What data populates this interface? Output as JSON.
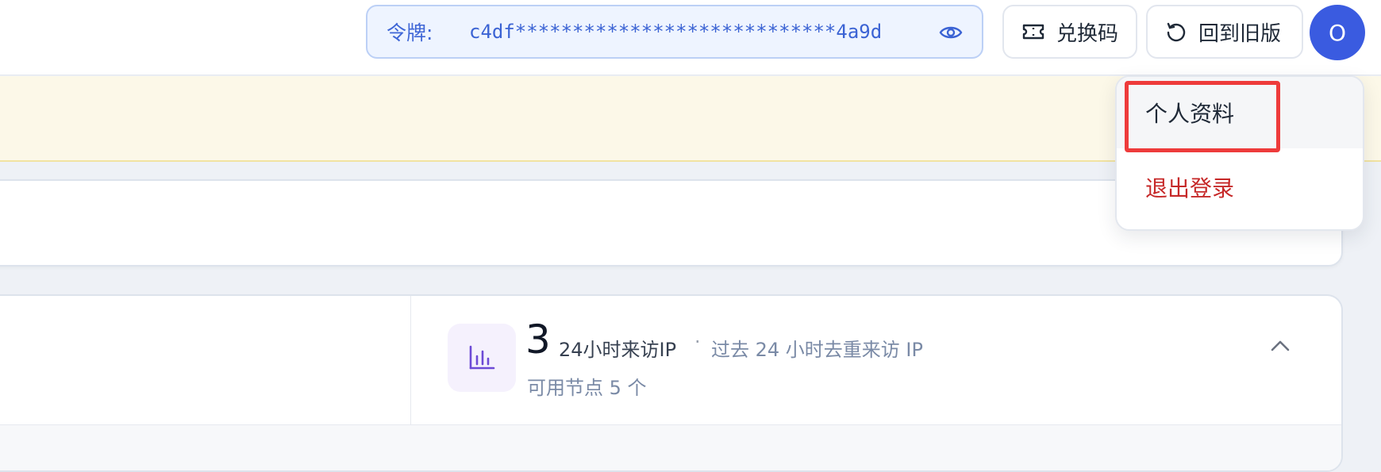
{
  "header": {
    "token_label": "令牌:",
    "token_value": "c4df****************************4a9d",
    "eye_icon": "eye-icon",
    "redeem_label": "兑换码",
    "redeem_icon": "ticket-icon",
    "old_version_label": "回到旧版",
    "old_version_icon": "rotate-ccw-icon",
    "avatar_initial": "O",
    "avatar_color": "#3a5be0"
  },
  "dropdown": {
    "items": [
      {
        "label": "个人资料",
        "icon": "",
        "highlighted": true
      },
      {
        "label": "退出登录",
        "color": "#c62828"
      }
    ]
  },
  "stat_card": {
    "icon": "bar-chart-icon",
    "value": "3",
    "label": "24小时来访IP",
    "separator": "·",
    "description": "过去 24 小时去重来访 IP",
    "sub": "可用节点 5 个",
    "collapse_icon": "chevron-up-icon"
  },
  "colors": {
    "accent": "#3b63d4",
    "banner": "#fcf8e8",
    "logout": "#c62828",
    "highlight_box": "#ee3b3b"
  }
}
